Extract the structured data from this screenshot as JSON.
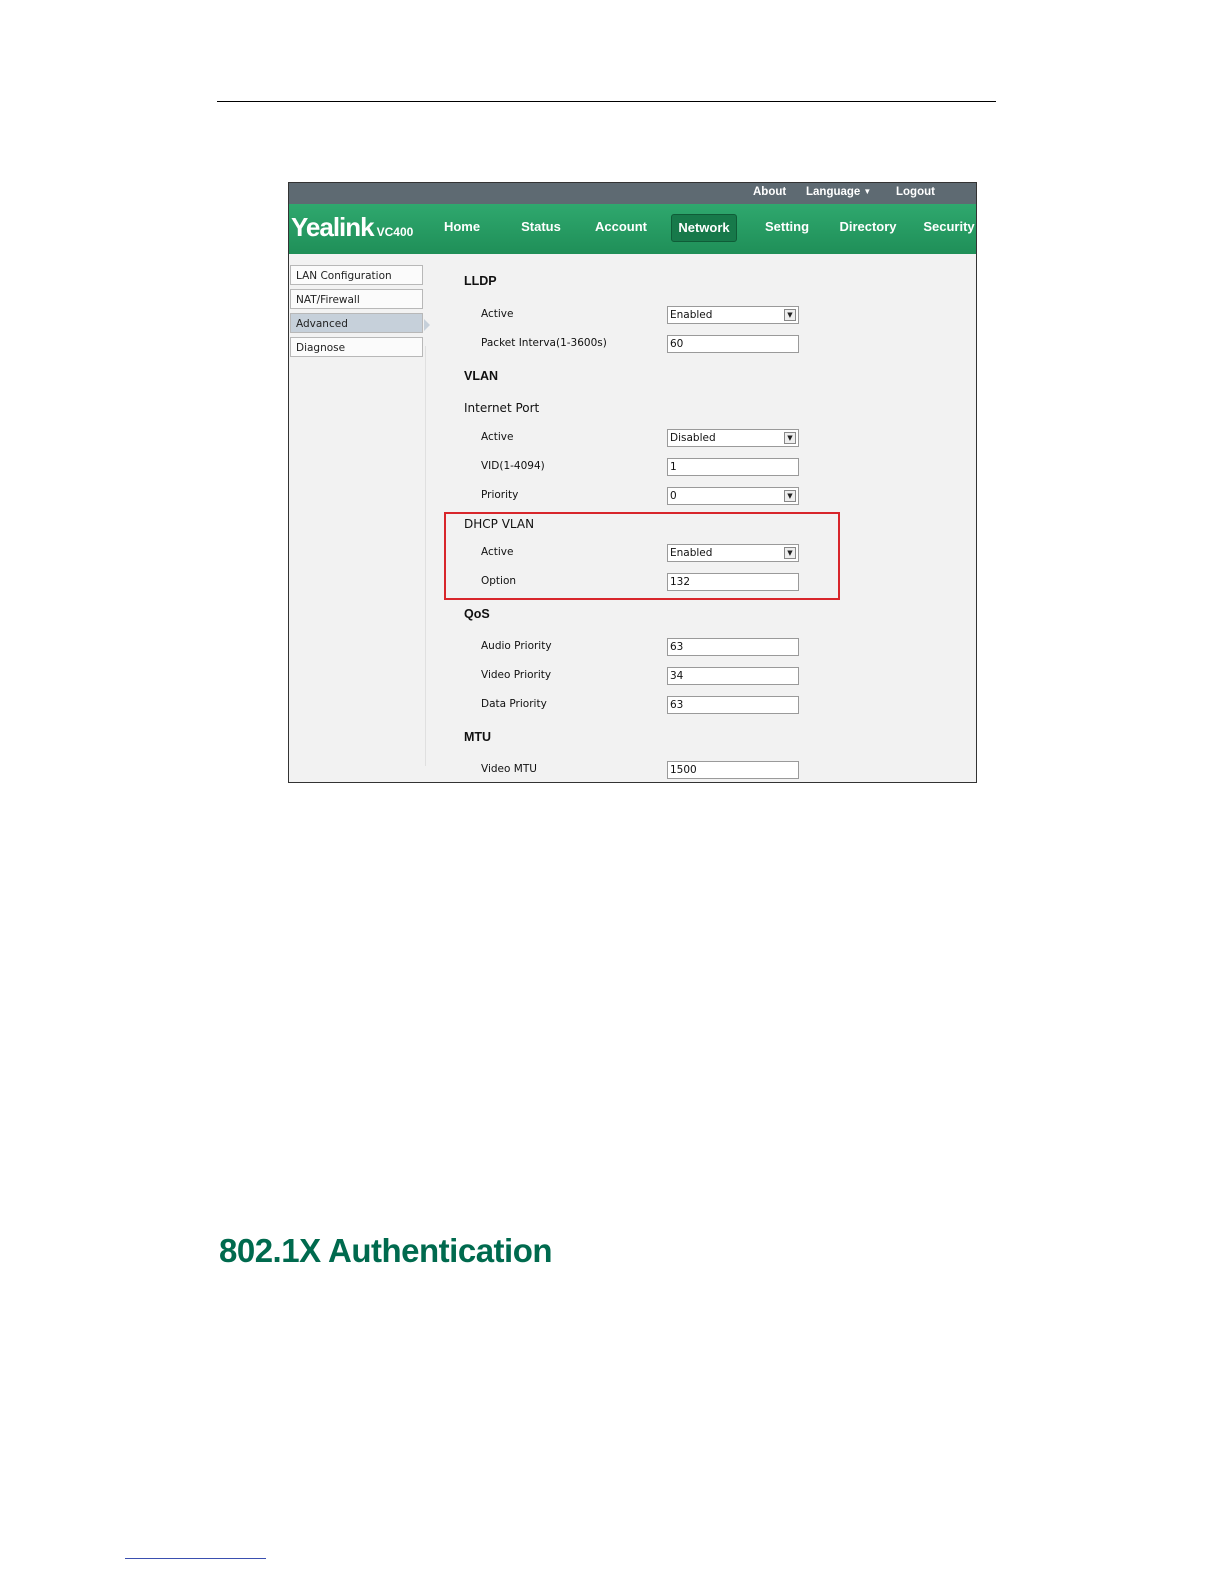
{
  "topbar": {
    "about": "About",
    "language": "Language",
    "logout": "Logout"
  },
  "brand": {
    "name": "Yealink",
    "model": "VC400"
  },
  "nav": {
    "tabs": [
      "Home",
      "Status",
      "Account",
      "Network",
      "Setting",
      "Directory",
      "Security"
    ],
    "active": "Network"
  },
  "sidebar": {
    "items": [
      "LAN Configuration",
      "NAT/Firewall",
      "Advanced",
      "Diagnose"
    ],
    "active": "Advanced"
  },
  "lldp": {
    "title": "LLDP",
    "active_label": "Active",
    "active_value": "Enabled",
    "interval_label": "Packet Interva(1-3600s)",
    "interval_value": "60"
  },
  "vlan": {
    "title": "VLAN",
    "internet_port": {
      "title": "Internet Port",
      "active_label": "Active",
      "active_value": "Disabled",
      "vid_label": "VID(1-4094)",
      "vid_value": "1",
      "priority_label": "Priority",
      "priority_value": "0"
    },
    "dhcp_vlan": {
      "title": "DHCP VLAN",
      "active_label": "Active",
      "active_value": "Enabled",
      "option_label": "Option",
      "option_value": "132"
    }
  },
  "qos": {
    "title": "QoS",
    "audio_label": "Audio Priority",
    "audio_value": "63",
    "video_label": "Video Priority",
    "video_value": "34",
    "data_label": "Data Priority",
    "data_value": "63"
  },
  "mtu": {
    "title": "MTU",
    "video_label": "Video MTU",
    "video_value": "1500"
  },
  "document": {
    "section_heading": "802.1X Authentication"
  }
}
